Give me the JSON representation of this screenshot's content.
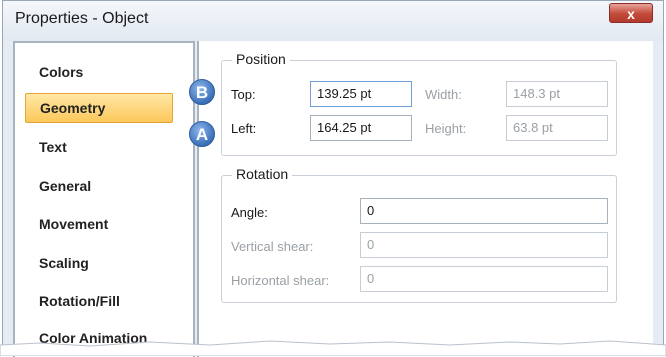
{
  "window": {
    "title": "Properties - Object",
    "close_label": "x"
  },
  "sidebar": {
    "items": [
      {
        "label": "Colors",
        "selected": false
      },
      {
        "label": "Geometry",
        "selected": true
      },
      {
        "label": "Text",
        "selected": false
      },
      {
        "label": "General",
        "selected": false
      },
      {
        "label": "Movement",
        "selected": false
      },
      {
        "label": "Scaling",
        "selected": false
      },
      {
        "label": "Rotation/Fill",
        "selected": false
      },
      {
        "label": "Color Animation",
        "selected": false
      }
    ]
  },
  "position": {
    "legend": "Position",
    "top_label": "Top:",
    "top_value": "139.25 pt",
    "left_label": "Left:",
    "left_value": "164.25 pt",
    "width_label": "Width:",
    "width_value": "148.3 pt",
    "height_label": "Height:",
    "height_value": "63.8 pt"
  },
  "rotation": {
    "legend": "Rotation",
    "angle_label": "Angle:",
    "angle_value": "0",
    "vshear_label": "Vertical shear:",
    "vshear_value": "0",
    "hshear_label": "Horizontal shear:",
    "hshear_value": "0"
  },
  "callouts": {
    "a": "A",
    "b": "B"
  },
  "colors": {
    "callout": "#3a6fb8",
    "selection": "#fbc75a",
    "close": "#c24a3a"
  }
}
